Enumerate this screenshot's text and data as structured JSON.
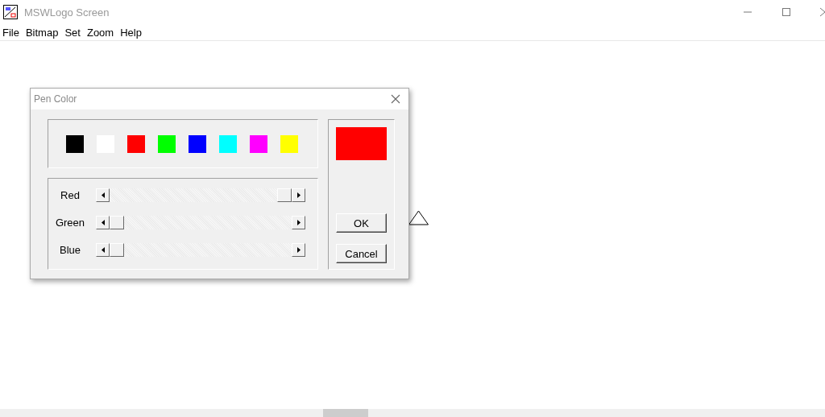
{
  "window": {
    "title": "MSWLogo Screen"
  },
  "menu": [
    "File",
    "Bitmap",
    "Set",
    "Zoom",
    "Help"
  ],
  "dialog": {
    "title": "Pen Color",
    "swatches": [
      {
        "color": "#000000"
      },
      {
        "color": "#ffffff"
      },
      {
        "color": "#ff0000"
      },
      {
        "color": "#00ff00"
      },
      {
        "color": "#0000ff"
      },
      {
        "color": "#00ffff"
      },
      {
        "color": "#ff00ff"
      },
      {
        "color": "#ffff00"
      }
    ],
    "sliders": [
      {
        "label": "Red",
        "level": 1
      },
      {
        "label": "Green",
        "level": 0
      },
      {
        "label": "Blue",
        "level": 0
      }
    ],
    "buttons": [
      "OK",
      "Cancel"
    ]
  }
}
